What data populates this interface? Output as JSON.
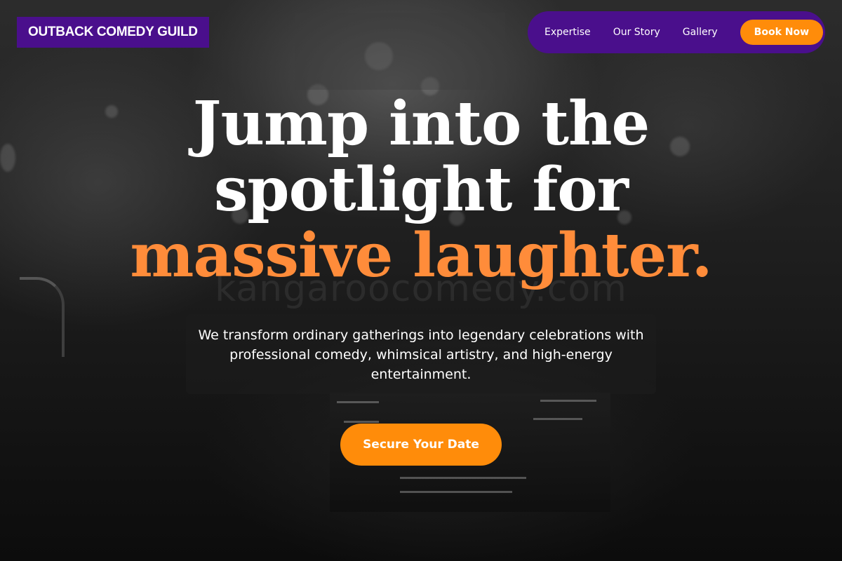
{
  "brand": {
    "name": "OUTBACK COMEDY GUILD"
  },
  "nav": {
    "links": [
      "Expertise",
      "Our Story",
      "Gallery"
    ],
    "cta_label": "Book Now"
  },
  "hero": {
    "headline_line1": "Jump into the",
    "headline_line2": "spotlight for",
    "headline_accent": "massive laughter.",
    "subtitle": "We transform ordinary gatherings into legendary celebrations with professional comedy, whimsical artistry, and high-energy entertainment.",
    "cta_label": "Secure Your Date",
    "watermark": "kangaroocomedy.com"
  },
  "colors": {
    "brand_purple": "#4a0f8c",
    "accent_orange": "#ff8c0a",
    "headline_accent": "#ff8c3a"
  }
}
